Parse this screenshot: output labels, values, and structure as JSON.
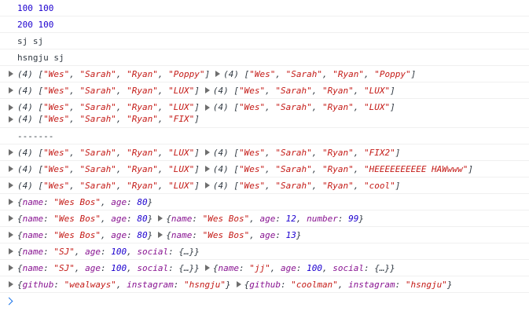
{
  "console": {
    "lines": [
      {
        "type": "num",
        "text": "100 100"
      },
      {
        "type": "num",
        "text": "200 100"
      },
      {
        "type": "plain",
        "text": "sj sj"
      },
      {
        "type": "plain",
        "text": "hsngju sj"
      },
      {
        "type": "arrays",
        "rows": [
          [
            [
              "Wes",
              "Sarah",
              "Ryan",
              "Poppy"
            ],
            [
              "Wes",
              "Sarah",
              "Ryan",
              "Poppy"
            ]
          ]
        ]
      },
      {
        "type": "arrays",
        "rows": [
          [
            [
              "Wes",
              "Sarah",
              "Ryan",
              "LUX"
            ],
            [
              "Wes",
              "Sarah",
              "Ryan",
              "LUX"
            ]
          ]
        ]
      },
      {
        "type": "arrays",
        "rows": [
          [
            [
              "Wes",
              "Sarah",
              "Ryan",
              "LUX"
            ],
            [
              "Wes",
              "Sarah",
              "Ryan",
              "LUX"
            ]
          ],
          [
            [
              "Wes",
              "Sarah",
              "Ryan",
              "FIX"
            ]
          ]
        ]
      },
      {
        "type": "plain",
        "text": "-------"
      },
      {
        "type": "arrays",
        "rows": [
          [
            [
              "Wes",
              "Sarah",
              "Ryan",
              "LUX"
            ],
            [
              "Wes",
              "Sarah",
              "Ryan",
              "FIX2"
            ]
          ]
        ]
      },
      {
        "type": "arrays",
        "rows": [
          [
            [
              "Wes",
              "Sarah",
              "Ryan",
              "LUX"
            ],
            [
              "Wes",
              "Sarah",
              "Ryan",
              "HEEEEEEEEEE  HAWwww"
            ]
          ]
        ]
      },
      {
        "type": "arrays",
        "rows": [
          [
            [
              "Wes",
              "Sarah",
              "Ryan",
              "LUX"
            ],
            [
              "Wes",
              "Sarah",
              "Ryan",
              "cool"
            ]
          ]
        ]
      },
      {
        "type": "objects",
        "objs": [
          [
            [
              "name",
              "\"Wes Bos\""
            ],
            [
              "age",
              "80"
            ]
          ]
        ]
      },
      {
        "type": "objects",
        "objs": [
          [
            [
              "name",
              "\"Wes Bos\""
            ],
            [
              "age",
              "80"
            ]
          ],
          [
            [
              "name",
              "\"Wes Bos\""
            ],
            [
              "age",
              "12"
            ],
            [
              "number",
              "99"
            ]
          ]
        ]
      },
      {
        "type": "objects",
        "objs": [
          [
            [
              "name",
              "\"Wes Bos\""
            ],
            [
              "age",
              "80"
            ]
          ],
          [
            [
              "name",
              "\"Wes Bos\""
            ],
            [
              "age",
              "13"
            ]
          ]
        ]
      },
      {
        "type": "objects",
        "objs": [
          [
            [
              "name",
              "\"SJ\""
            ],
            [
              "age",
              "100"
            ],
            [
              "social",
              "{…}"
            ]
          ]
        ]
      },
      {
        "type": "objects",
        "objs": [
          [
            [
              "name",
              "\"SJ\""
            ],
            [
              "age",
              "100"
            ],
            [
              "social",
              "{…}"
            ]
          ],
          [
            [
              "name",
              "\"jj\""
            ],
            [
              "age",
              "100"
            ],
            [
              "social",
              "{…}"
            ]
          ]
        ]
      },
      {
        "type": "objects",
        "objs": [
          [
            [
              "github",
              "\"wealways\""
            ],
            [
              "instagram",
              "\"hsngju\""
            ]
          ],
          [
            [
              "github",
              "\"coolman\""
            ],
            [
              "instagram",
              "\"hsngju\""
            ]
          ]
        ]
      }
    ],
    "array_prefix": "(4)",
    "prompt_icon": "chevron-right-icon"
  }
}
